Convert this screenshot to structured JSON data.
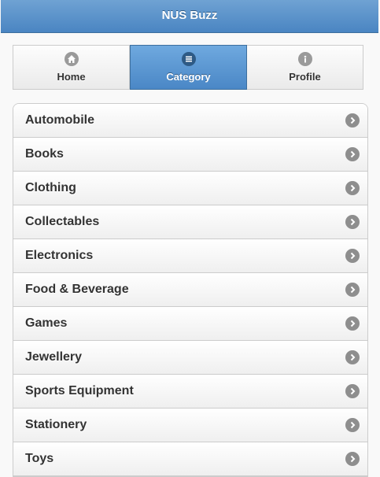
{
  "header": {
    "title": "NUS Buzz"
  },
  "navbar": {
    "tabs": [
      {
        "label": "Home",
        "icon": "home-icon"
      },
      {
        "label": "Category",
        "icon": "bars-icon",
        "active": true
      },
      {
        "label": "Profile",
        "icon": "info-icon"
      }
    ]
  },
  "categories": {
    "items": [
      {
        "label": "Automobile"
      },
      {
        "label": "Books"
      },
      {
        "label": "Clothing"
      },
      {
        "label": "Collectables"
      },
      {
        "label": "Electronics"
      },
      {
        "label": "Food & Beverage"
      },
      {
        "label": "Games"
      },
      {
        "label": "Jewellery"
      },
      {
        "label": "Sports Equipment"
      },
      {
        "label": "Stationery"
      },
      {
        "label": "Toys"
      }
    ]
  },
  "colors": {
    "accent": "#4a87c6",
    "header": "#5b93cb"
  }
}
